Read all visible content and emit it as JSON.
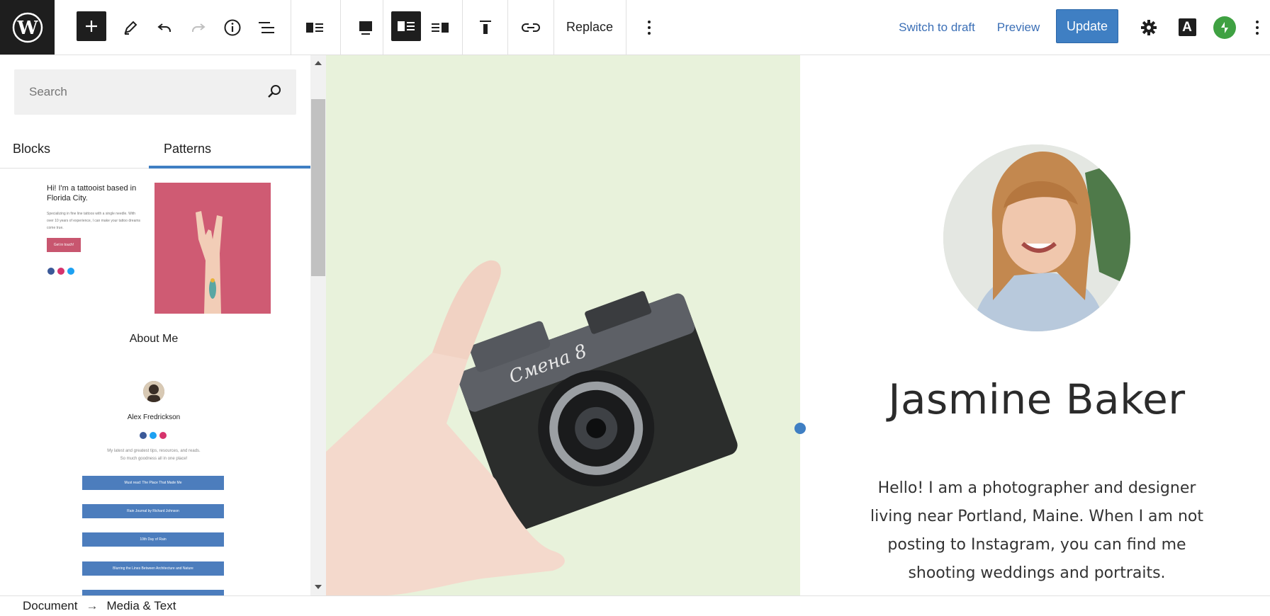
{
  "toolbar": {
    "replace_label": "Replace",
    "switch_to_draft_label": "Switch to draft",
    "preview_label": "Preview",
    "update_label": "Update",
    "font_icon_letter": "A",
    "accent_color": "#3f7fc3"
  },
  "sidebar": {
    "search_placeholder": "Search",
    "tabs": [
      {
        "label": "Blocks",
        "active": false
      },
      {
        "label": "Patterns",
        "active": true
      }
    ],
    "patterns": [
      {
        "title": "About Me",
        "heading": "Hi! I'm a tattooist based in Florida City.",
        "body": "Specializing in fine line tattoos with a single needle. With over 10 years of experience, I can make your tattoo dreams come true.",
        "button": "Get in touch!"
      },
      {
        "name": "Alex Fredrickson",
        "bio_line1": "My latest and greatest tips, resources, and reads.",
        "bio_line2": "So much goodness all in one place!",
        "links": [
          "Must read: The Place That Made Me",
          "Rain Journal by Richard Johnson",
          "10th Day of Rain",
          "Blurring the Lines Between Architecture and Nature"
        ]
      }
    ]
  },
  "canvas": {
    "name": "Jasmine Baker",
    "bio": "Hello! I am a photographer and designer living near Portland, Maine. When I am not posting to Instagram, you can find me shooting weddings and portraits."
  },
  "breadcrumb": {
    "items": [
      "Document",
      "Media & Text"
    ],
    "separator": "→"
  }
}
